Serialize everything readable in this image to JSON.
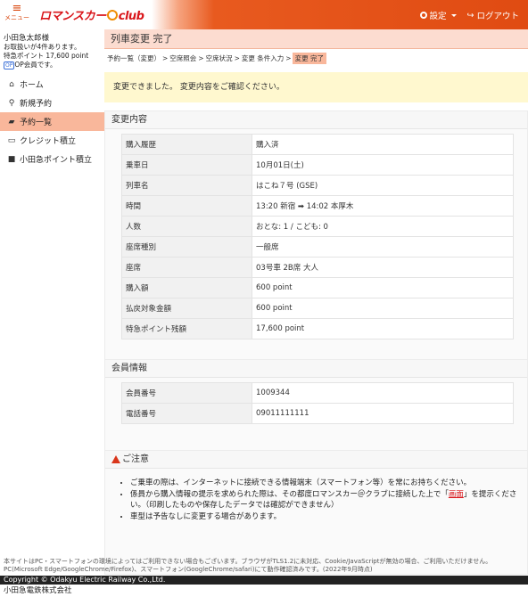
{
  "header": {
    "menu_label": "メニュー",
    "logo_left": "ロマンスカー",
    "logo_right": "club",
    "settings_label": "設定",
    "logout_label": "ログアウト"
  },
  "sidebar": {
    "user_name": "小田急太郎様",
    "reservations_note": "お取扱いが4件あります。",
    "points_note": "特急ポイント 17,600 point",
    "op_badge": "OP",
    "op_member": "OP会員です。",
    "items": [
      {
        "label": "ホーム",
        "icon": "home-icon"
      },
      {
        "label": "新規予約",
        "icon": "search-icon"
      },
      {
        "label": "予約一覧",
        "icon": "folder-open-icon"
      },
      {
        "label": "クレジット積立",
        "icon": "credit-card-icon"
      },
      {
        "label": "小田急ポイント積立",
        "icon": "wallet-icon"
      }
    ]
  },
  "main": {
    "title": "列車変更 完了",
    "breadcrumb": [
      "予約一覧（変更）",
      "空席照会",
      "空席状況",
      "変更 条件入力",
      "変更 完了"
    ],
    "success_message": "変更できました。 変更内容をご確認ください。",
    "change_section": {
      "title": "変更内容",
      "rows": [
        {
          "k": "購入履歴",
          "v": "購入済"
        },
        {
          "k": "乗車日",
          "v": "10月01日(土)"
        },
        {
          "k": "列車名",
          "v": "はこね７号 (GSE)"
        },
        {
          "k": "時間",
          "v": "13:20 新宿 ➡ 14:02 本厚木"
        },
        {
          "k": "人数",
          "v": "おとな: 1 / こども: 0"
        },
        {
          "k": "座席種別",
          "v": "一般席"
        },
        {
          "k": "座席",
          "v": "03号車 2B席 大人"
        },
        {
          "k": "購入額",
          "v": "600 point"
        },
        {
          "k": "払戻対象金額",
          "v": "600 point"
        },
        {
          "k": "特急ポイント残額",
          "v": "17,600 point"
        }
      ]
    },
    "member_section": {
      "title": "会員情報",
      "rows": [
        {
          "k": "会員番号",
          "v": "1009344"
        },
        {
          "k": "電話番号",
          "v": "09011111111"
        }
      ]
    },
    "notice_section": {
      "title": "ご注意",
      "items": [
        "ご乗車の際は、インターネットに接続できる情報端末（スマートフォン等）を常にお持ちください。",
        "車型は予告なしに変更する場合があります。"
      ],
      "item2_before": "係員から購入情報の提示を求められた際は、その都度ロマンスカー＠クラブに接続した上で「",
      "item2_link": "画面",
      "item2_after": "」を提示ください。（印刷したものや保存したデータでは確認ができません）"
    }
  },
  "footer": {
    "note": "本サイトはPC・スマートフォンの環境によってはご利用できない場合もございます。ブラウザがTLS1.2に未対応、Cookie/JavaScriptが無効の場合、ご利用いただけません。 PC(Microsoft Edge/GoogleChrome/Firefox)、スマートフォン(GoogleChrome/safari)にて動作確認済みです。(2022年9月時点)",
    "copyright": "Copyright © Odakyu Electric Railway Co.,Ltd.",
    "company": "小田急電鉄株式会社"
  }
}
